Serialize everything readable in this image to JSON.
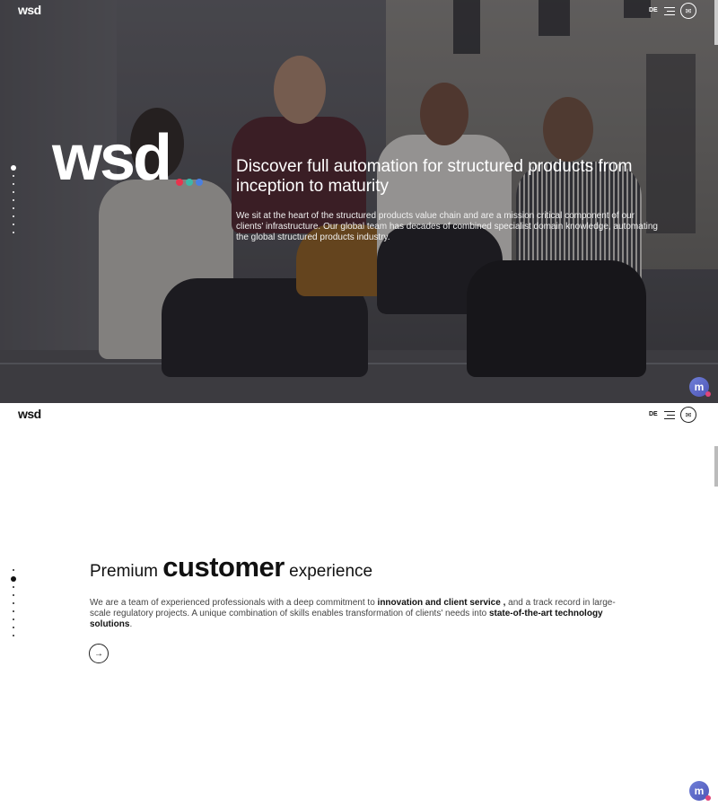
{
  "brand": {
    "logo_text": "wsd",
    "dot_colors": [
      "#e8344e",
      "#3cb7a8",
      "#4a7fe0"
    ]
  },
  "header": {
    "logo": "wsd",
    "lang": "DE",
    "menu_icon": "hamburger-menu-icon",
    "mail_icon": "mail-icon"
  },
  "hero": {
    "logo_text": "wsd",
    "title": "Discover full automation for structured products from inception to maturity",
    "text": "We sit at the heart of the structured products value chain and are a mission critical component of our clients' infrastructure. Our global team has decades of combined specialist domain knowledge, automating the global structured products industry."
  },
  "section2": {
    "title_prefix": "Premium",
    "title_emphasis": "customer",
    "title_suffix": "experience",
    "text_part1": "We are a team of experienced professionals with a deep commitment to ",
    "text_bold1": "innovation and client service ,",
    "text_part2": " and a track record in large-scale regulatory projects. A unique combination of skills enables transformation of clients' needs into ",
    "text_bold2": "state-of-the-art technology solutions",
    "text_end": ".",
    "arrow": "→"
  },
  "chat_widget": {
    "label": "m"
  },
  "side_nav": {
    "hero_active_index": 0,
    "section2_active_index": 1,
    "dot_count": 9
  }
}
